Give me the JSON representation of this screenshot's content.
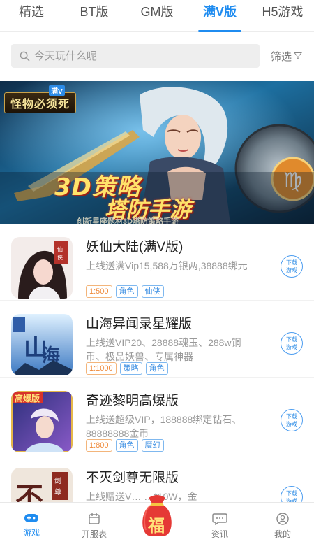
{
  "tabs": [
    {
      "label": "精选",
      "active": false
    },
    {
      "label": "BT版",
      "active": false
    },
    {
      "label": "GM版",
      "active": false
    },
    {
      "label": "满V版",
      "active": true
    },
    {
      "label": "H5游戏",
      "active": false
    }
  ],
  "search": {
    "placeholder": "今天玩什么呢",
    "filter_label": "筛选"
  },
  "banner": {
    "title": "怪物必须死",
    "badge": "满V",
    "headline1": "3D策略",
    "headline2": "塔防手游",
    "subline": "创新星座题材3D塔防策略手游"
  },
  "games": [
    {
      "name": "妖仙大陆(满V版)",
      "desc": "上线送满Vip15,588万银两,38888绑元",
      "tags": [
        "1:500",
        "角色",
        "仙侠"
      ],
      "download": "下载游戏"
    },
    {
      "name": "山海异闻录星耀版",
      "desc": "上线送VIP20、28888魂玉、288w铜币、极品妖兽、专属神器",
      "tags": [
        "1:1000",
        "策略",
        "角色"
      ],
      "download": "下载游戏"
    },
    {
      "name": "奇迹黎明高爆版",
      "desc": "上线送超级VIP，188888绑定钻石、88888888金币",
      "tags": [
        "1:800",
        "角色",
        "魔幻"
      ],
      "download": "下载游戏"
    },
    {
      "name": "不灭剑尊无限版",
      "desc": "上线赠送V… …*10W，金",
      "tags": [],
      "download": "下载游戏"
    }
  ],
  "bottom_nav": [
    {
      "label": "游戏",
      "icon": "gamepad-icon",
      "active": true
    },
    {
      "label": "开服表",
      "icon": "calendar-icon",
      "active": false
    },
    {
      "label": "",
      "icon": "fortune-bag-icon",
      "active": false
    },
    {
      "label": "资讯",
      "icon": "chat-bubble-icon",
      "active": false
    },
    {
      "label": "我的",
      "icon": "user-icon",
      "active": false
    }
  ],
  "fortune_char": "福",
  "colors": {
    "accent": "#1f8cf0",
    "ratio_tag": "#ef8a3a",
    "fortune_red": "#e53935"
  }
}
